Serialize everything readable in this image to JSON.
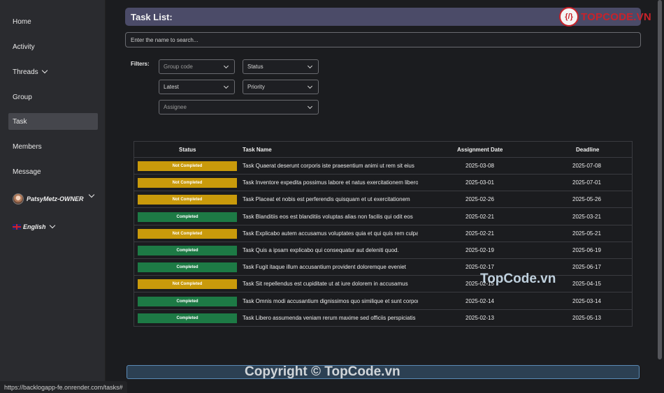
{
  "sidebar": {
    "items": [
      {
        "label": "Home"
      },
      {
        "label": "Activity"
      },
      {
        "label": "Threads"
      },
      {
        "label": "Group"
      },
      {
        "label": "Task"
      },
      {
        "label": "Members"
      },
      {
        "label": "Message"
      }
    ],
    "user": "PatsyMetz-OWNER",
    "language": "English"
  },
  "main": {
    "title": "Task List:",
    "search_placeholder": "Enter the name to search...",
    "filters_label": "Filters:",
    "filters": {
      "group_code": "Group code",
      "status": "Status",
      "sort": "Latest",
      "priority": "Priority",
      "assignee": "Assignee"
    }
  },
  "table": {
    "headers": {
      "status": "Status",
      "name": "Task Name",
      "assign": "Assignment Date",
      "deadline": "Deadline"
    },
    "rows": [
      {
        "status": "Not Completed",
        "name": "Task Quaerat deserunt corporis iste praesentium animi ut rem sit eius",
        "assign": "2025-03-08",
        "deadline": "2025-07-08"
      },
      {
        "status": "Not Completed",
        "name": "Task Inventore expedita possimus labore et natus exercitationem libero",
        "assign": "2025-03-01",
        "deadline": "2025-07-01"
      },
      {
        "status": "Not Completed",
        "name": "Task Placeat et nobis est perferendis quisquam et ut exercitationem",
        "assign": "2025-02-26",
        "deadline": "2025-05-26"
      },
      {
        "status": "Completed",
        "name": "Task Blanditiis eos est blanditiis voluptas alias non facilis qui odit eos",
        "assign": "2025-02-21",
        "deadline": "2025-03-21"
      },
      {
        "status": "Not Completed",
        "name": "Task Explicabo autem accusamus voluptates quia et qui quis rem culpa",
        "assign": "2025-02-21",
        "deadline": "2025-05-21"
      },
      {
        "status": "Completed",
        "name": "Task Quis a ipsam explicabo qui consequatur aut deleniti quod.",
        "assign": "2025-02-19",
        "deadline": "2025-06-19"
      },
      {
        "status": "Completed",
        "name": "Task Fugit itaque illum accusantium provident doloremque eveniet",
        "assign": "2025-02-17",
        "deadline": "2025-06-17"
      },
      {
        "status": "Not Completed",
        "name": "Task Sit repellendus est cupiditate ut at iure dolorem in accusamus",
        "assign": "2025-02-15",
        "deadline": "2025-04-15"
      },
      {
        "status": "Completed",
        "name": "Task Omnis modi accusantium dignissimos quo similique et sunt corporis",
        "assign": "2025-02-14",
        "deadline": "2025-03-14"
      },
      {
        "status": "Completed",
        "name": "Task Libero assumenda veniam rerum maxime sed officiis perspiciatis",
        "assign": "2025-02-13",
        "deadline": "2025-05-13"
      }
    ]
  },
  "statusbar": {
    "url": "https://backlogapp-fe.onrender.com/tasks#"
  },
  "watermarks": {
    "copyright": "Copyright © TopCode.vn",
    "mid": "TopCode.vn",
    "logo_text": "TOPCODE.VN",
    "logo_mark": "{/}"
  },
  "colors": {
    "not_completed": "#c99a0b",
    "completed": "#1d7a45",
    "title_bar": "#4b4b68",
    "sidebar_active": "#45464c"
  }
}
